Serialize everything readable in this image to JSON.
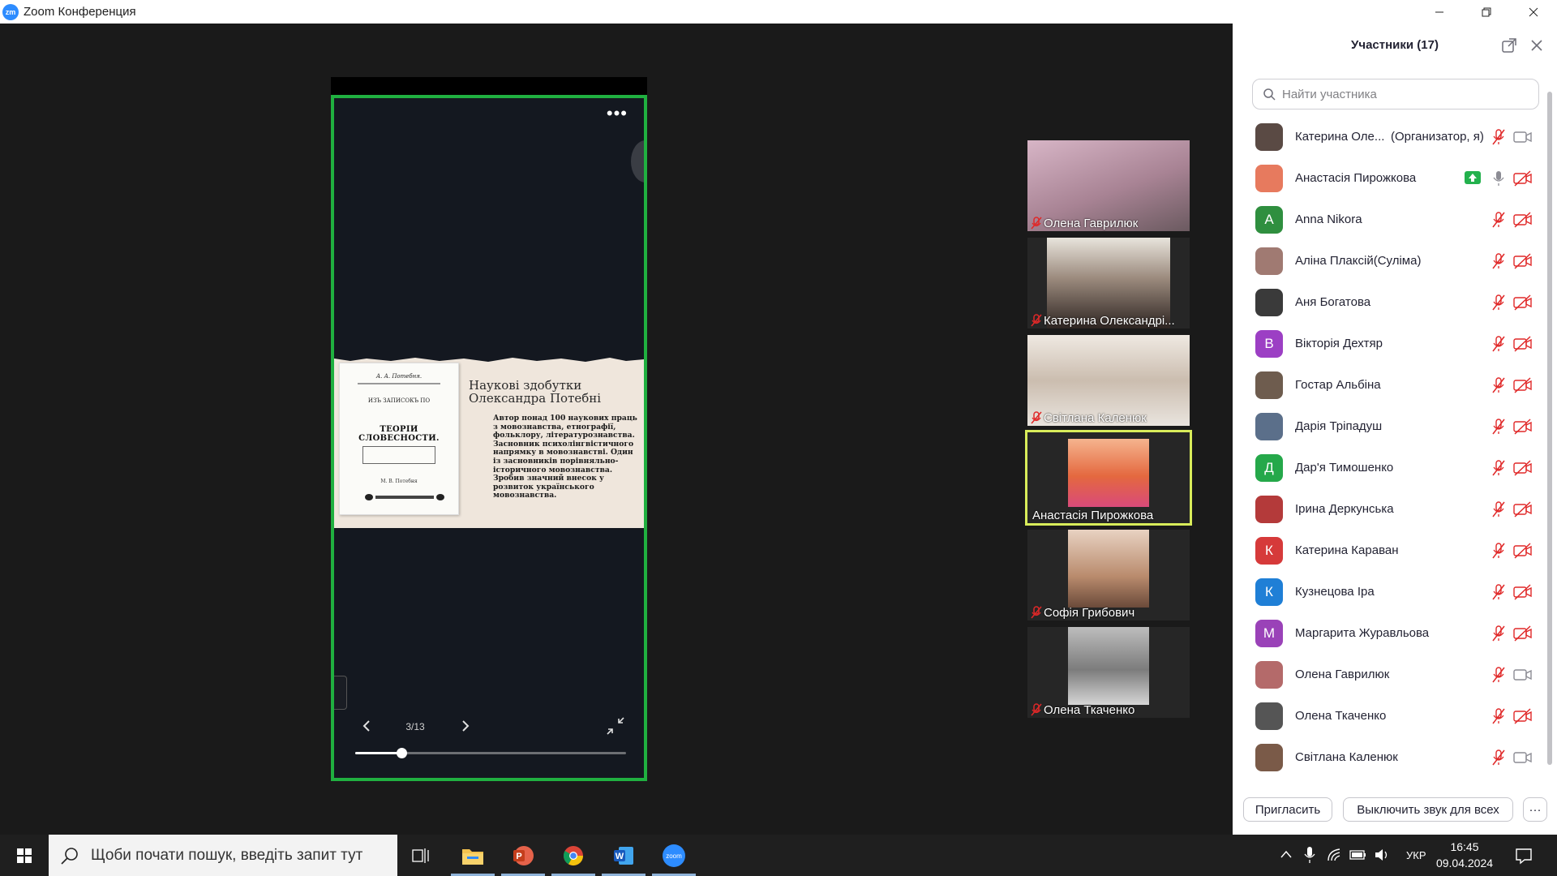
{
  "window": {
    "title": "Zoom Конференция",
    "logo_text": "zm"
  },
  "share": {
    "menu_icon": "more-dots-icon",
    "slide": {
      "book_top_label": "А. А. Потебня.",
      "book_title_small": "ИЗЪ ЗАПИСОКЪ ПО",
      "book_title_main": "ТЕОРІИ СЛОВЕСНОСТИ.",
      "book_author": "М. В. Потебня",
      "heading": "Наукові здобутки Олександра Потебні",
      "text": "Автор понад 100 наукових праць з мовознавства, етнографії, фольклору, літературознавства. Засновник психолінгвістичного напрямку в мовознавстві. Один із засновників порівняльно-історичного мовознавства. Зробив значний внесок у розвиток українського мовознавства."
    },
    "controls": {
      "counter": "3/13",
      "progress_fraction": 0.17
    }
  },
  "tiles": [
    {
      "name": "Олена Гаврилюк",
      "muted": true,
      "active": false,
      "bg": "#b89aa8"
    },
    {
      "name": "Катерина Олександрі...",
      "muted": true,
      "active": false,
      "bg": "#6c5a52"
    },
    {
      "name": "Світлана Каленюк",
      "muted": true,
      "active": false,
      "bg": "#cfc3b6"
    },
    {
      "name": "Анастасія Пирожкова",
      "muted": false,
      "active": true,
      "bg": "#e46a4c"
    },
    {
      "name": "Софія Грибович",
      "muted": true,
      "active": false,
      "bg": "#c6a08c"
    },
    {
      "name": "Олена Ткаченко",
      "muted": true,
      "active": false,
      "bg": "#9a9a9a"
    }
  ],
  "panel": {
    "title": "Участники (17)",
    "search_placeholder": "Найти участника",
    "participants": [
      {
        "name": "Катерина Оле...",
        "role": "(Организатор, я)",
        "avatar_letter": "",
        "avatar_color": "#5a4a44",
        "mic_muted": true,
        "cam_off": false,
        "sharing": false
      },
      {
        "name": "Анастасія Пирожкова",
        "role": "",
        "avatar_letter": "",
        "avatar_color": "#e77a5e",
        "mic_muted": false,
        "cam_off": true,
        "sharing": true
      },
      {
        "name": "Anna Nikora",
        "role": "",
        "avatar_letter": "A",
        "avatar_color": "#2f8f3f",
        "mic_muted": true,
        "cam_off": true,
        "sharing": false
      },
      {
        "name": "Аліна Плаксій(Суліма)",
        "role": "",
        "avatar_letter": "",
        "avatar_color": "#a07a72",
        "mic_muted": true,
        "cam_off": true,
        "sharing": false
      },
      {
        "name": "Аня Богатова",
        "role": "",
        "avatar_letter": "",
        "avatar_color": "#3a3a3a",
        "mic_muted": true,
        "cam_off": true,
        "sharing": false
      },
      {
        "name": "Вікторія Дехтяр",
        "role": "",
        "avatar_letter": "B",
        "avatar_color": "#9c3fc4",
        "mic_muted": true,
        "cam_off": true,
        "sharing": false
      },
      {
        "name": "Гостар Альбіна",
        "role": "",
        "avatar_letter": "",
        "avatar_color": "#6e5c4e",
        "mic_muted": true,
        "cam_off": true,
        "sharing": false
      },
      {
        "name": "Дарія Тріпадуш",
        "role": "",
        "avatar_letter": "",
        "avatar_color": "#5b6f8a",
        "mic_muted": true,
        "cam_off": true,
        "sharing": false
      },
      {
        "name": "Дар'я Тимошенко",
        "role": "",
        "avatar_letter": "Д",
        "avatar_color": "#25a84a",
        "mic_muted": true,
        "cam_off": true,
        "sharing": false
      },
      {
        "name": "Ірина Деркунська",
        "role": "",
        "avatar_letter": "",
        "avatar_color": "#b43a3a",
        "mic_muted": true,
        "cam_off": true,
        "sharing": false
      },
      {
        "name": "Катерина Караван",
        "role": "",
        "avatar_letter": "К",
        "avatar_color": "#d63a3a",
        "mic_muted": true,
        "cam_off": true,
        "sharing": false
      },
      {
        "name": "Кузнецова Іра",
        "role": "",
        "avatar_letter": "К",
        "avatar_color": "#1f7fd6",
        "mic_muted": true,
        "cam_off": true,
        "sharing": false
      },
      {
        "name": "Маргарита Журавльова",
        "role": "",
        "avatar_letter": "М",
        "avatar_color": "#9a42b8",
        "mic_muted": true,
        "cam_off": true,
        "sharing": false
      },
      {
        "name": "Олена Гаврилюк",
        "role": "",
        "avatar_letter": "",
        "avatar_color": "#b46a6a",
        "mic_muted": true,
        "cam_off": false,
        "sharing": false
      },
      {
        "name": "Олена Ткаченко",
        "role": "",
        "avatar_letter": "",
        "avatar_color": "#555555",
        "mic_muted": true,
        "cam_off": true,
        "sharing": false
      },
      {
        "name": "Світлана Каленюк",
        "role": "",
        "avatar_letter": "",
        "avatar_color": "#7a5a48",
        "mic_muted": true,
        "cam_off": false,
        "sharing": false
      }
    ],
    "footer": {
      "invite": "Пригласить",
      "mute_all": "Выключить звук для всех",
      "more": "···"
    }
  },
  "taskbar": {
    "search_placeholder": "Щоби почати пошук, введіть запит тут",
    "apps": [
      "task-view",
      "file-explorer",
      "powerpoint",
      "chrome",
      "word",
      "zoom"
    ],
    "language": "УКР",
    "time": "16:45",
    "date": "09.04.2024"
  },
  "colors": {
    "share_border": "#20b040",
    "active_speaker": "#d8ec5a",
    "muted_red": "#e02828",
    "zoom_blue": "#2d8cff"
  }
}
